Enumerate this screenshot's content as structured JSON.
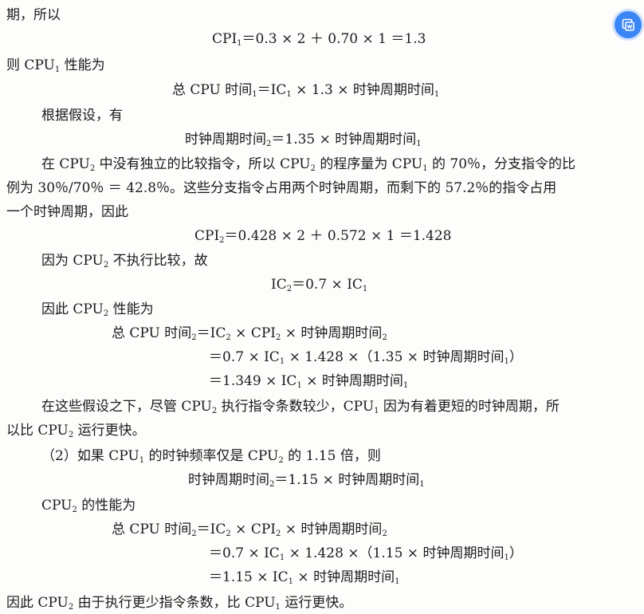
{
  "doc": {
    "line1": "期，所以",
    "line2": {
      "a": "CPI",
      "s1": "1",
      "b": "＝0.3 × 2 ＋ 0.70 × 1 ＝1.3"
    },
    "line3": {
      "a": "则 CPU",
      "s1": "1",
      "b": " 性能为"
    },
    "line4": {
      "a": "总 CPU 时间",
      "s1": "1",
      "b": "＝IC",
      "s2": "1",
      "c": " × 1.3 × 时钟周期时间",
      "s3": "1"
    },
    "line5": "根据假设，有",
    "line6": {
      "a": "时钟周期时间",
      "s1": "2",
      "b": "＝1.35 × 时钟周期时间",
      "s2": "1"
    },
    "line7": {
      "a": "在 CPU",
      "s1": "2",
      "b": " 中没有独立的比较指令，所以 CPU",
      "s2": "2",
      "c": " 的程序量为 CPU",
      "s3": "1",
      "d": " 的 70％，分支指令的比"
    },
    "line8": "例为 30％/70％ ＝ 42.8％。这些分支指令占用两个时钟周期，而剩下的 57.2％的指令占用",
    "line9": "一个时钟周期，因此",
    "line10": {
      "a": "CPI",
      "s1": "2",
      "b": "＝0.428 × 2 ＋ 0.572 × 1 ＝1.428"
    },
    "line11": {
      "a": "因为 CPU",
      "s1": "2",
      "b": " 不执行比较，故"
    },
    "line12": {
      "a": "IC",
      "s1": "2",
      "b": "＝0.7 × IC",
      "s2": "1"
    },
    "line13": {
      "a": "因此 CPU",
      "s1": "2",
      "b": " 性能为"
    },
    "line14": {
      "a": "总 CPU 时间",
      "s1": "2",
      "b": "＝IC",
      "s2": "2",
      "c": " × CPI",
      "s3": "2",
      "d": " × 时钟周期时间",
      "s4": "2"
    },
    "line15": {
      "a": "＝0.7 × IC",
      "s1": "1",
      "b": " × 1.428 ×（1.35 × 时钟周期时间",
      "s2": "1",
      "c": "）"
    },
    "line16": {
      "a": "＝1.349 × IC",
      "s1": "1",
      "b": " × 时钟周期时间",
      "s2": "1"
    },
    "line17": {
      "a": "在这些假设之下，尽管 CPU",
      "s1": "2",
      "b": " 执行指令条数较少，CPU",
      "s2": "1",
      "c": " 因为有着更短的时钟周期，所"
    },
    "line18": {
      "a": "以比 CPU",
      "s1": "2",
      "b": " 运行更快。"
    },
    "line19": {
      "a": "（2）如果 CPU",
      "s1": "1",
      "b": " 的时钟频率仅是 CPU",
      "s2": "2",
      "c": " 的 1.15 倍，则"
    },
    "line20": {
      "a": "时钟周期时间",
      "s1": "2",
      "b": "＝1.15 × 时钟周期时间",
      "s2": "1"
    },
    "line21": {
      "a": "CPU",
      "s1": "2",
      "b": " 的性能为"
    },
    "line22": {
      "a": "总 CPU 时间",
      "s1": "2",
      "b": "＝IC",
      "s2": "2",
      "c": " × CPI",
      "s3": "2",
      "d": " × 时钟周期时间",
      "s4": "2"
    },
    "line23": {
      "a": "＝0.7 × IC",
      "s1": "1",
      "b": " × 1.428 ×（1.15 × 时钟周期时间",
      "s2": "1",
      "c": "）"
    },
    "line24": {
      "a": "＝1.15 × IC",
      "s1": "1",
      "b": " × 时钟周期时间",
      "s2": "1"
    },
    "line25": {
      "a": "因此 CPU",
      "s1": "2",
      "b": " 由于执行更少指令条数，比 CPU",
      "s2": "1",
      "c": " 运行更快。"
    }
  },
  "float_button": {
    "icon": "translate-icon",
    "color": "#3a86f5"
  }
}
